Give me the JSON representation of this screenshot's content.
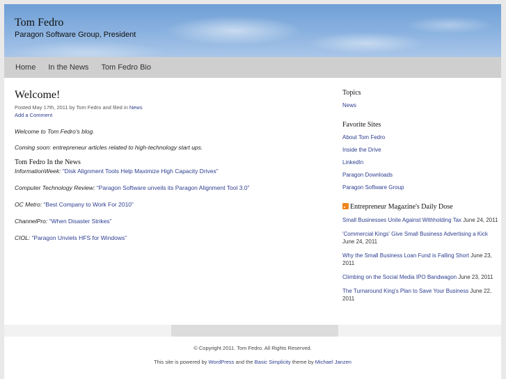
{
  "header": {
    "title": "Tom Fedro",
    "description": "Paragon Software Group, President"
  },
  "nav": {
    "items": [
      "Home",
      "In the News",
      "Tom Fedro Bio"
    ]
  },
  "post": {
    "title": "Welcome!",
    "meta_prefix": "Posted May 17th, 2011 by Tom Fedro and filed in",
    "meta_category": "News",
    "comment_link": "Add a Comment",
    "intro": "Welcome to Tom Fedro's blog.",
    "coming_soon": "Coming soon: entrepreneur articles related to high-technology start ups.",
    "news_heading": "Tom Fedro In the News",
    "news": [
      {
        "source": "InformationWeek:",
        "link": "“Disk Alignment Tools Help Maximize High Capacity Drives”"
      },
      {
        "source": "Computer Technology Review:",
        "link": "“Paragon Software unveils its Paragon Alignment Tool 3.0”"
      },
      {
        "source": "OC Metro:",
        "link": "“Best Company to Work For 2010”"
      },
      {
        "source": "ChannelPro:",
        "link": "“When Disaster Strikes”"
      },
      {
        "source": "CIOL:",
        "link": "“Paragon Unviels HFS for Windows”"
      }
    ]
  },
  "sidebar": {
    "topics_heading": "Topics",
    "topics": [
      "News"
    ],
    "favorites_heading": "Favorite Sites",
    "favorites": [
      "About Tom Fedro",
      "Inside the Drive",
      "LinkedIn",
      "Paragon Downloads",
      "Paragon Software Group"
    ],
    "feed_heading": "Entrepreneur Magazine's Daily Dose",
    "feed": [
      {
        "title": "Small Businesses Unite Against Withholding Tax",
        "date": "June 24, 2011"
      },
      {
        "title": "'Commercial Kings' Give Small Business Advertising a Kick",
        "date": "June 24, 2011"
      },
      {
        "title": "Why the Small Business Loan Fund is Falling Short",
        "date": "June 23, 2011"
      },
      {
        "title": "Climbing on the Social Media IPO Bandwagon",
        "date": "June 23, 2011"
      },
      {
        "title": "The Turnaround King's Plan to Save Your Business",
        "date": "June 22, 2011"
      }
    ]
  },
  "footer": {
    "copyright": "© Copyright 2011. Tom Fedro. All Rights Reserved.",
    "powered_prefix": "This site is powered by",
    "wordpress": "WordPress",
    "and_the": "and the",
    "theme_name": "Basic Simplicity",
    "theme_by": "theme by",
    "author": "Michael Janzen"
  },
  "colors": {
    "link": "#2c3d8f",
    "nav_bg": "#cfcfcf",
    "rss": "#f0861b"
  }
}
